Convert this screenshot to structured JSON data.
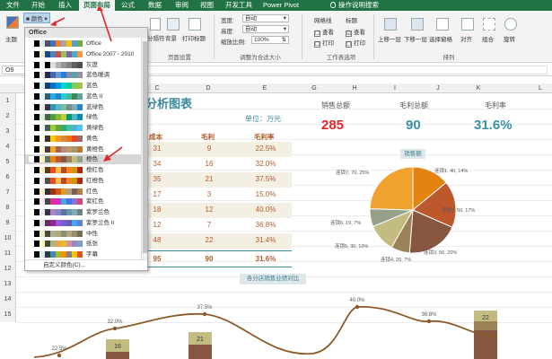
{
  "ribbon": {
    "tabs": [
      "文件",
      "开始",
      "插入",
      "页面布局",
      "公式",
      "数据",
      "审阅",
      "视图",
      "开发工具",
      "Power Pivot"
    ],
    "active_tab": "页面布局",
    "tell_me": "操作说明搜索",
    "theme_group": {
      "theme_label": "主题",
      "colors_label": "颜色"
    },
    "page_setup": {
      "break_label": "分隔符",
      "background_label": "背景",
      "print_titles_label": "打印标题",
      "margins_label": "页边距",
      "orientation_label": "方向",
      "size_label": "纸张大小",
      "print_area_label": "打印区域",
      "label": "页面设置"
    },
    "scale_to_fit": {
      "width_label": "宽度:",
      "width_value": "自动",
      "height_label": "高度:",
      "height_value": "自动",
      "scale_label": "缩放比例:",
      "scale_value": "100%",
      "label": "调整为合适大小"
    },
    "sheet_options": {
      "gridlines_label": "网格线",
      "headings_label": "标题",
      "view_label": "查看",
      "print_label": "打印",
      "gridlines_view": "☐",
      "headings_view": "☑",
      "gridlines_print": "☐",
      "headings_print": "☐",
      "label": "工作表选项"
    },
    "arrange": {
      "bring_forward": "上移一层",
      "send_backward": "下移一层",
      "selection_pane": "选择窗格",
      "align": "对齐",
      "group": "组合",
      "rotate": "旋转",
      "label": "排列"
    }
  },
  "name_box": "O9",
  "column_headers": [
    "C",
    "D",
    "E",
    "G",
    "H",
    "I",
    "J",
    "K",
    "L"
  ],
  "row_headers": [
    "1",
    "2",
    "3",
    "4",
    "5",
    "6",
    "7",
    "8",
    "9",
    "10",
    "11",
    "12",
    "13",
    "14",
    "15"
  ],
  "dropdown": {
    "header": "Office",
    "items": [
      {
        "name": "Office",
        "colors": [
          "#ffffff",
          "#000000",
          "#e7e6e6",
          "#44546a",
          "#4472c4",
          "#ed7d31",
          "#a5a5a5",
          "#ffc000",
          "#5b9bd5",
          "#70ad47"
        ]
      },
      {
        "name": "Office 2007 - 2010",
        "colors": [
          "#ffffff",
          "#000000",
          "#eeece1",
          "#1f497d",
          "#4f81bd",
          "#c0504d",
          "#9bbb59",
          "#8064a2",
          "#4bacc6",
          "#f79646"
        ]
      },
      {
        "name": "灰度",
        "colors": [
          "#ffffff",
          "#000000",
          "#f8f8f8",
          "#000000",
          "#dddddd",
          "#b2b2b2",
          "#969696",
          "#808080",
          "#5f5f5f",
          "#4d4d4d"
        ]
      },
      {
        "name": "蓝色暖调",
        "colors": [
          "#ffffff",
          "#000000",
          "#ebebeb",
          "#242852",
          "#4a66ac",
          "#629dd1",
          "#297fd5",
          "#7f8fa9",
          "#5aa2ae",
          "#9d90a0"
        ]
      },
      {
        "name": "蓝色",
        "colors": [
          "#ffffff",
          "#000000",
          "#dbeff9",
          "#17406d",
          "#0f6fc6",
          "#009dd9",
          "#0bd0d9",
          "#10cf9b",
          "#7cca62",
          "#a5c249"
        ]
      },
      {
        "name": "蓝色 II",
        "colors": [
          "#ffffff",
          "#000000",
          "#dbf5f9",
          "#335b74",
          "#1cade4",
          "#2683c6",
          "#27ced7",
          "#42ba97",
          "#3e8853",
          "#62a39f"
        ]
      },
      {
        "name": "蓝绿色",
        "colors": [
          "#ffffff",
          "#000000",
          "#ebebeb",
          "#373545",
          "#3494ba",
          "#58b6c0",
          "#75bda7",
          "#7a8c8e",
          "#84acb6",
          "#2683c6"
        ]
      },
      {
        "name": "绿色",
        "colors": [
          "#ffffff",
          "#000000",
          "#dbefd3",
          "#455f51",
          "#549e39",
          "#8ab833",
          "#c0cf3a",
          "#029676",
          "#4ab5c4",
          "#0989b1"
        ]
      },
      {
        "name": "黄绿色",
        "colors": [
          "#ffffff",
          "#000000",
          "#f2f2f2",
          "#455f51",
          "#99cb38",
          "#63a537",
          "#37a76f",
          "#44c1a3",
          "#4eb3cf",
          "#51c3f9"
        ]
      },
      {
        "name": "黄色",
        "colors": [
          "#ffffff",
          "#000000",
          "#fffcf0",
          "#39302a",
          "#ffca08",
          "#f8931d",
          "#ce8d3e",
          "#ec7016",
          "#e64823",
          "#9c6a6a"
        ]
      },
      {
        "name": "黄橙色",
        "colors": [
          "#ffffff",
          "#000000",
          "#fff5e6",
          "#4e3b30",
          "#f0a22e",
          "#a5644e",
          "#b58b80",
          "#c3986d",
          "#a19574",
          "#c17529"
        ]
      },
      {
        "name": "橙色",
        "colors": [
          "#ffffff",
          "#000000",
          "#fbeec9",
          "#637052",
          "#e48312",
          "#bd582c",
          "#865640",
          "#9b8357",
          "#c2bc80",
          "#94a088"
        ]
      },
      {
        "name": "橙红色",
        "colors": [
          "#ffffff",
          "#000000",
          "#fbeec9",
          "#5e3a1a",
          "#e84c22",
          "#ffbd47",
          "#b64926",
          "#ff8427",
          "#cc9900",
          "#b22600"
        ]
      },
      {
        "name": "红橙色",
        "colors": [
          "#ffffff",
          "#000000",
          "#f2f2f2",
          "#505046",
          "#e84c22",
          "#ffbd47",
          "#b64926",
          "#ff8427",
          "#cc9900",
          "#b22600"
        ]
      },
      {
        "name": "红色",
        "colors": [
          "#ffffff",
          "#000000",
          "#ffeed0",
          "#323232",
          "#a5300f",
          "#d55816",
          "#e19825",
          "#b19c7d",
          "#7f5f52",
          "#b27d49"
        ]
      },
      {
        "name": "紫红色",
        "colors": [
          "#ffffff",
          "#000000",
          "#f8e6ea",
          "#454551",
          "#e32d91",
          "#c830cc",
          "#4ea6dc",
          "#4775e7",
          "#8971e1",
          "#d54773"
        ]
      },
      {
        "name": "紫罗兰色",
        "colors": [
          "#ffffff",
          "#000000",
          "#eee9f5",
          "#373545",
          "#ad84c6",
          "#8784c7",
          "#5d739a",
          "#6997af",
          "#84acb6",
          "#6f8183"
        ]
      },
      {
        "name": "紫罗兰色 II",
        "colors": [
          "#ffffff",
          "#000000",
          "#e8e1ef",
          "#632e62",
          "#92278f",
          "#9b57d3",
          "#755dd9",
          "#665eb8",
          "#45a5ed",
          "#5982db"
        ]
      },
      {
        "name": "中性",
        "colors": [
          "#ffffff",
          "#000000",
          "#ece9c6",
          "#4d4736",
          "#acac93",
          "#aaab7a",
          "#8b8e6a",
          "#b5a584",
          "#998c6f",
          "#7a6d57"
        ]
      },
      {
        "name": "纸张",
        "colors": [
          "#ffffff",
          "#000000",
          "#fefac9",
          "#444d26",
          "#a5b592",
          "#f3a447",
          "#e7bc29",
          "#d092a7",
          "#9c85c0",
          "#809ec2"
        ]
      },
      {
        "name": "字幕",
        "colors": [
          "#ffffff",
          "#000000",
          "#dde9ec",
          "#2b3b44",
          "#418ab3",
          "#a6b727",
          "#f69200",
          "#838383",
          "#fec306",
          "#df5327"
        ]
      }
    ],
    "highlighted": "橙色",
    "custom_colors": "自定义颜色(C)..."
  },
  "sheet": {
    "title": "分析图表",
    "unit": "单位：万元",
    "table_headers": [
      "成本",
      "毛利",
      "毛利率"
    ],
    "rows": [
      {
        "cost": "31",
        "profit": "9",
        "margin": "22.5%"
      },
      {
        "cost": "34",
        "profit": "16",
        "margin": "32.0%"
      },
      {
        "cost": "35",
        "profit": "21",
        "margin": "37.5%"
      },
      {
        "cost": "17",
        "profit": "3",
        "margin": "15.0%"
      },
      {
        "cost": "18",
        "profit": "12",
        "margin": "40.0%"
      },
      {
        "cost": "12",
        "profit": "7",
        "margin": "36.8%"
      },
      {
        "cost": "48",
        "profit": "22",
        "margin": "31.4%"
      }
    ],
    "total": {
      "cost": "95",
      "profit": "90",
      "margin": "31.6%"
    },
    "kpis": [
      {
        "label": "销售总额",
        "value": "285",
        "color": "#e0262b"
      },
      {
        "label": "毛利总额",
        "value": "90",
        "color": "#3a8fa8"
      },
      {
        "label": "毛利率",
        "value": "31.6%",
        "color": "#3a8fa8"
      }
    ],
    "pie_chip": "销售额",
    "combo_chip": "各分店销售业绩对比"
  },
  "chart_data": [
    {
      "type": "pie",
      "title": "销售额",
      "labels": [
        "连锁1",
        "连锁2",
        "连锁3",
        "连锁4",
        "连锁5",
        "连锁6",
        "连锁7"
      ],
      "values": [
        40,
        50,
        56,
        20,
        30,
        19,
        70
      ],
      "percentages": [
        14,
        17,
        20,
        7,
        10,
        7,
        25
      ],
      "label_texts": [
        "连锁1, 40, 14%",
        "连锁2, 50, 17%",
        "连锁3, 56, 20%",
        "连锁4, 20, 7%",
        "连锁5, 30, 10%",
        "连锁6, 19, 7%",
        "连锁7, 70, 25%"
      ],
      "colors": [
        "#e48312",
        "#bd582c",
        "#865640",
        "#9b8357",
        "#c2bc80",
        "#94a088",
        "#f0a22e"
      ]
    },
    {
      "type": "bar",
      "title": "各分店销售业绩对比",
      "bar_labels": [
        "16",
        "21",
        "22"
      ],
      "line_labels": [
        "22.5%",
        "32.0%",
        "37.5%",
        "40.0%",
        "36.8%"
      ]
    }
  ]
}
